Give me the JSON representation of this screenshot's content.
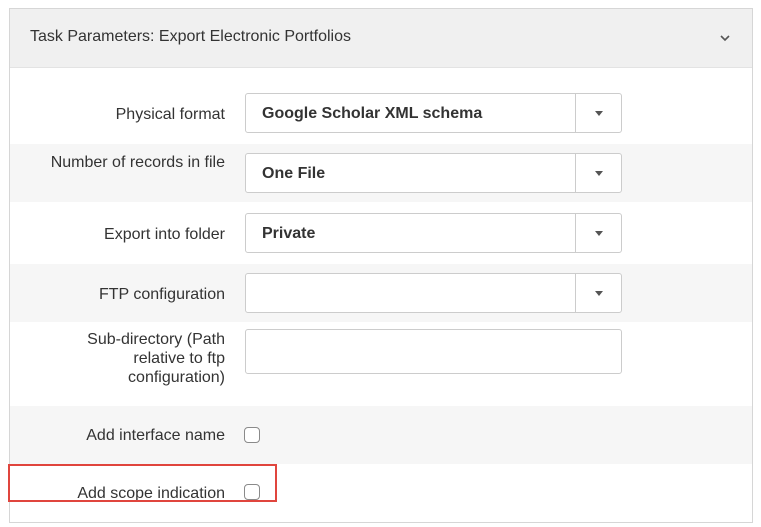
{
  "panel": {
    "title": "Task Parameters: Export Electronic Portfolios",
    "collapse_icon": "chevron-down-icon"
  },
  "fields": {
    "physical_format": {
      "label": "Physical format",
      "value": "Google Scholar XML schema",
      "icon": "caret-down-icon"
    },
    "records_in_file": {
      "label": "Number of records in file",
      "value": "One File",
      "icon": "caret-down-icon"
    },
    "export_folder": {
      "label": "Export into folder",
      "value": "Private",
      "icon": "caret-down-icon"
    },
    "ftp_configuration": {
      "label": "FTP configuration",
      "value": "",
      "icon": "caret-down-icon"
    },
    "sub_directory": {
      "label": "Sub-directory (Path relative to ftp configuration)",
      "value": ""
    },
    "add_interface_name": {
      "label": "Add interface name",
      "checked": false
    },
    "add_scope_indication": {
      "label": "Add scope indication",
      "checked": false
    }
  },
  "colors": {
    "highlight": "#e0453d",
    "header_bg": "#f0f0f0",
    "alt_row_bg": "#f6f6f6"
  }
}
